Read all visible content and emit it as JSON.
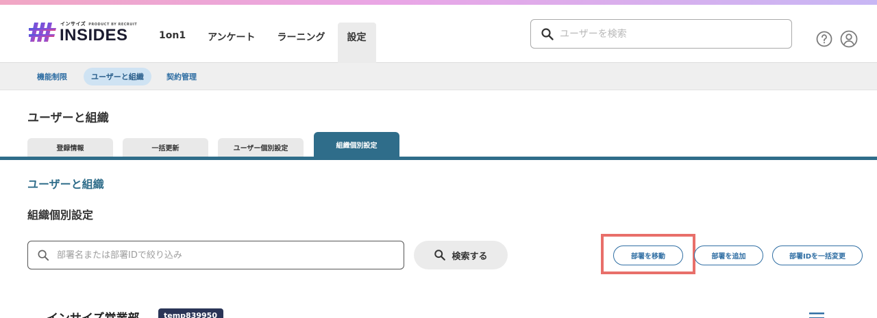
{
  "brand": {
    "logo_small": "インサイズ",
    "logo_by": "PRODUCT BY RECRUIT",
    "logo_main": "INSIDES"
  },
  "nav": {
    "items": [
      {
        "label": "1on1",
        "active": false
      },
      {
        "label": "アンケート",
        "active": false
      },
      {
        "label": "ラーニング",
        "active": false
      },
      {
        "label": "設定",
        "active": true
      }
    ]
  },
  "global_search": {
    "placeholder": "ユーザーを検索",
    "icon": "search-icon"
  },
  "header_icons": [
    "help-icon",
    "user-avatar-icon"
  ],
  "subnav": {
    "items": [
      {
        "label": "機能制限",
        "active": false
      },
      {
        "label": "ユーザーと組織",
        "active": true
      },
      {
        "label": "契約管理",
        "active": false
      }
    ]
  },
  "page": {
    "title": "ユーザーと組織"
  },
  "tabs": [
    {
      "label": "登録情報",
      "active": false
    },
    {
      "label": "一括更新",
      "active": false
    },
    {
      "label": "ユーザー個別設定",
      "active": false
    },
    {
      "label": "組織個別設定",
      "active": true
    }
  ],
  "section": {
    "breadcrumb": "ユーザーと組織",
    "title": "組織個別設定"
  },
  "filter": {
    "placeholder": "部署名または部署IDで絞り込み",
    "search_button": "検索する"
  },
  "actions": {
    "move_dept": "部署を移動",
    "add_dept": "部署を追加",
    "bulk_change_id": "部署IDを一括変更"
  },
  "department": {
    "name": "インサイズ営業部",
    "id": "temp839950"
  },
  "colors": {
    "accent": "#2f6d8a",
    "link": "#2f6ea3",
    "highlight": "#e86f6a",
    "badge": "#2a3557"
  }
}
